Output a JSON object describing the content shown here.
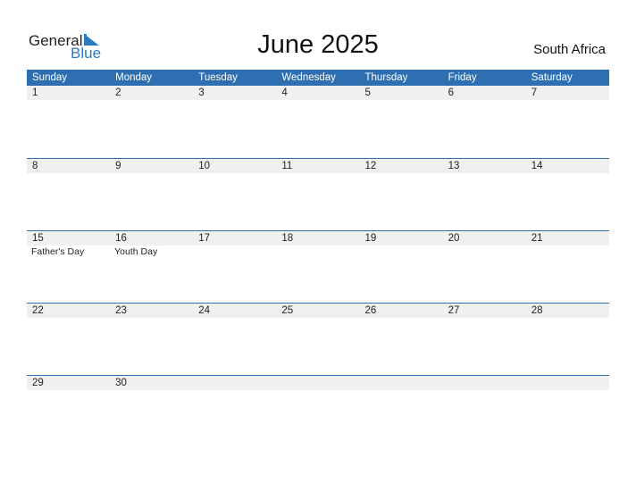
{
  "logo": {
    "word1": "General",
    "word2": "Blue"
  },
  "title": "June 2025",
  "country": "South Africa",
  "colors": {
    "accent": "#2e6fb1",
    "date_band": "#f0f0f0"
  },
  "weekdays": [
    "Sunday",
    "Monday",
    "Tuesday",
    "Wednesday",
    "Thursday",
    "Friday",
    "Saturday"
  ],
  "weeks": [
    {
      "dates": [
        "1",
        "2",
        "3",
        "4",
        "5",
        "6",
        "7"
      ],
      "events": [
        "",
        "",
        "",
        "",
        "",
        "",
        ""
      ]
    },
    {
      "dates": [
        "8",
        "9",
        "10",
        "11",
        "12",
        "13",
        "14"
      ],
      "events": [
        "",
        "",
        "",
        "",
        "",
        "",
        ""
      ]
    },
    {
      "dates": [
        "15",
        "16",
        "17",
        "18",
        "19",
        "20",
        "21"
      ],
      "events": [
        "Father's Day",
        "Youth Day",
        "",
        "",
        "",
        "",
        ""
      ]
    },
    {
      "dates": [
        "22",
        "23",
        "24",
        "25",
        "26",
        "27",
        "28"
      ],
      "events": [
        "",
        "",
        "",
        "",
        "",
        "",
        ""
      ]
    },
    {
      "dates": [
        "29",
        "30",
        "",
        "",
        "",
        "",
        ""
      ],
      "events": [
        "",
        "",
        "",
        "",
        "",
        "",
        ""
      ]
    }
  ]
}
